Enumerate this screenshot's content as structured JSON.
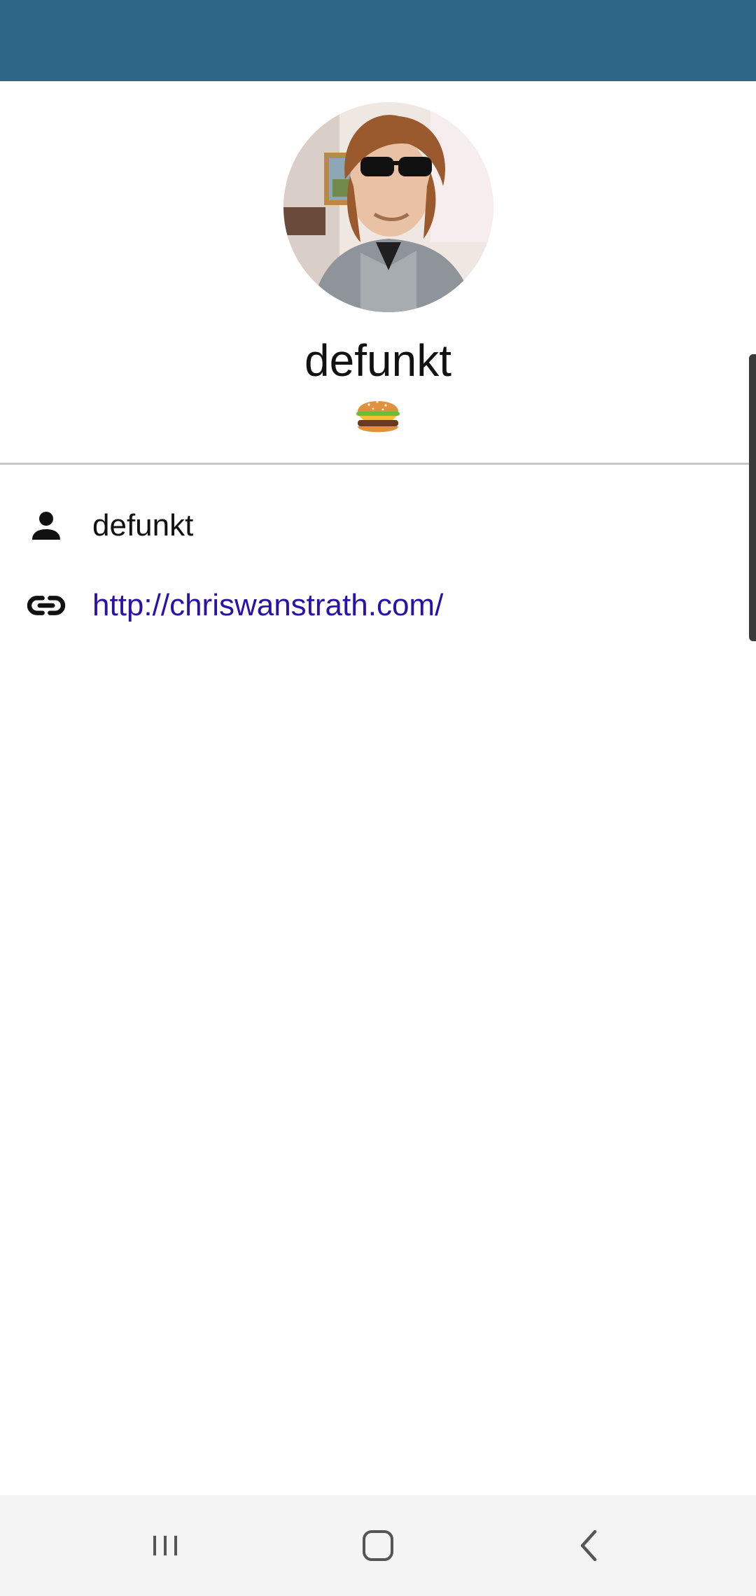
{
  "profile": {
    "name": "defunkt",
    "status_emoji": "hamburger"
  },
  "details": {
    "username": "defunkt",
    "website": "http://chriswanstrath.com/"
  },
  "colors": {
    "app_bar": "#2e6688",
    "link": "#2a11a8",
    "text": "#111111",
    "divider": "#c8c8c8",
    "nav_bar": "#f4f4f4"
  },
  "icons": {
    "username": "person-icon",
    "website": "link-icon",
    "nav_recents": "recents-icon",
    "nav_home": "home-icon",
    "nav_back": "back-icon"
  }
}
